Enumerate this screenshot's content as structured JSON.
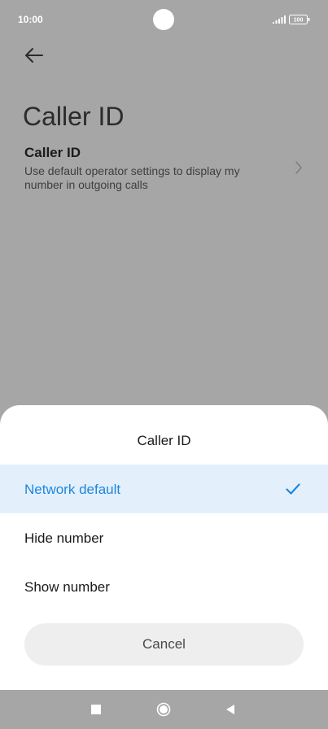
{
  "status_bar": {
    "time": "10:00",
    "battery": "100",
    "icons": [
      "signal-icon",
      "battery-icon"
    ]
  },
  "page": {
    "title": "Caller ID",
    "back_icon": "arrow-left-icon",
    "setting": {
      "title": "Caller ID",
      "summary": "Use default operator settings to display my number in outgoing calls",
      "icon": "chevron-right-icon"
    }
  },
  "sheet": {
    "title": "Caller ID",
    "options": [
      {
        "label": "Network default",
        "selected": true
      },
      {
        "label": "Hide number",
        "selected": false
      },
      {
        "label": "Show number",
        "selected": false
      }
    ],
    "cancel_label": "Cancel"
  },
  "nav_bar": {
    "icons": [
      "recents-square-icon",
      "home-circle-icon",
      "back-triangle-icon"
    ]
  },
  "colors": {
    "scrim": "#a6a6a6",
    "accent": "#1e87dc",
    "selected_bg": "#e3f0fc",
    "cancel_bg": "#eeeeee"
  }
}
